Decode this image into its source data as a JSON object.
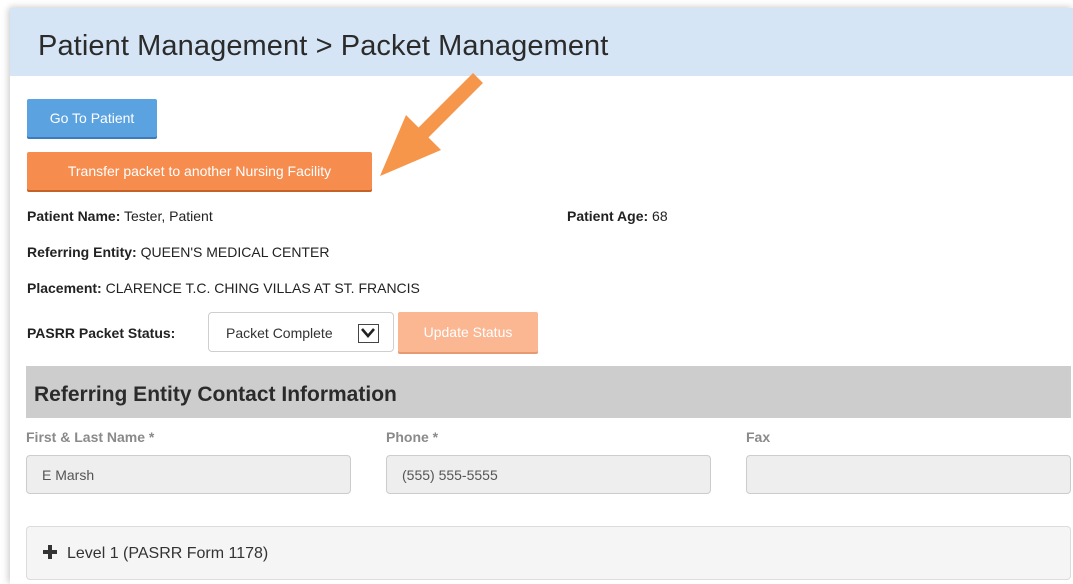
{
  "header": {
    "title": "Patient Management > Packet Management",
    "background_color": "#d5e5f5"
  },
  "actions": {
    "go_to_patient_label": "Go To Patient",
    "transfer_label": "Transfer packet to another Nursing Facility",
    "go_to_patient_color": "#5aa2e0",
    "transfer_color": "#f68c4e"
  },
  "patient": {
    "name_label": "Patient Name:",
    "name_value": "Tester, Patient",
    "age_label": "Patient Age:",
    "age_value": "68",
    "referring_label": "Referring Entity:",
    "referring_value": "QUEEN'S MEDICAL CENTER",
    "placement_label": "Placement:",
    "placement_value": "CLARENCE T.C. CHING VILLAS AT ST. FRANCIS"
  },
  "status": {
    "label": "PASRR Packet Status:",
    "selected": "Packet Complete",
    "update_label": "Update Status",
    "update_color": "#fbb692"
  },
  "contact_section": {
    "title": "Referring Entity Contact Information",
    "fields": [
      {
        "label": "First & Last Name *",
        "value": ""
      },
      {
        "label": "Phone *",
        "value": "(555) 555-5555"
      },
      {
        "label": "Fax",
        "value": ""
      }
    ],
    "name_value": "E Marsh"
  },
  "accordion": {
    "level1_label": "Level 1 (PASRR Form 1178)",
    "icon": "plus-icon"
  },
  "annotation": {
    "arrow_color": "#f5964a",
    "icon": "pointer-arrow-icon"
  }
}
